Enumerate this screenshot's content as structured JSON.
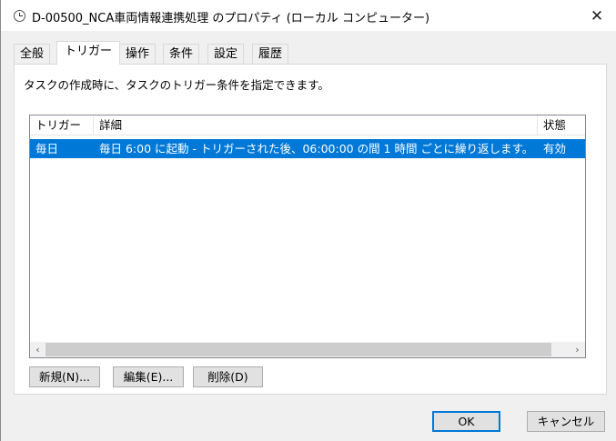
{
  "window": {
    "title": "D-00500_NCA車両情報連携処理 のプロパティ (ローカル コンピューター)",
    "close_glyph": "✕"
  },
  "tabs": [
    {
      "label": "全般",
      "active": false
    },
    {
      "label": "トリガー",
      "active": true
    },
    {
      "label": "操作",
      "active": false
    },
    {
      "label": "条件",
      "active": false
    },
    {
      "label": "設定",
      "active": false
    },
    {
      "label": "履歴",
      "active": false
    }
  ],
  "triggers_page": {
    "description": "タスクの作成時に、タスクのトリガー条件を指定できます。",
    "columns": [
      "トリガー",
      "詳細",
      "状態"
    ],
    "rows": [
      {
        "trigger": "毎日",
        "detail": "毎日 6:00 に起動 - トリガーされた後、06:00:00 の間 1 時間 ごとに繰り返します。",
        "status": "有効",
        "selected": true
      }
    ],
    "scroll_left_glyph": "‹",
    "scroll_right_glyph": "›",
    "buttons": {
      "new": "新規(N)...",
      "edit": "編集(E)...",
      "delete": "削除(D)"
    }
  },
  "footer": {
    "ok": "OK",
    "cancel": "キャンセル"
  },
  "colors": {
    "selection": "#0078d7",
    "dialog_bg": "#f0f0f0",
    "panel_bg": "#ffffff"
  }
}
